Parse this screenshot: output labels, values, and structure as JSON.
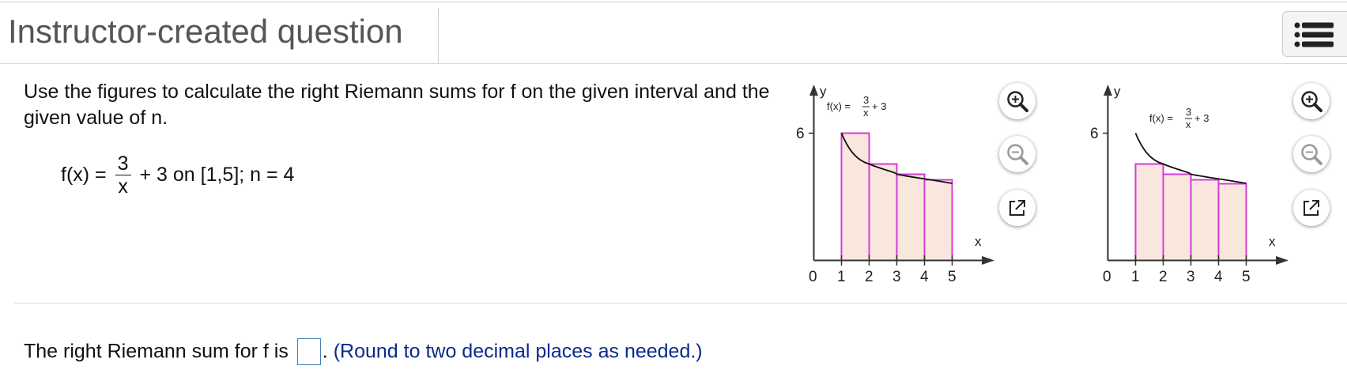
{
  "header": {
    "title": "Instructor-created question"
  },
  "question": {
    "prompt": "Use the figures to calculate the  right Riemann sums for f on the given interval and the given value of n.",
    "formula_lhs": "f(x) =",
    "formula_num": "3",
    "formula_den": "x",
    "formula_rhs": "+ 3 on [1,5]; n = 4"
  },
  "graph1": {
    "y_label": "y",
    "x_label": "x",
    "func_lhs": "f(x) =",
    "func_num": "3",
    "func_den": "x",
    "func_rhs": "+ 3",
    "y_tick": "6",
    "x_ticks": [
      "0",
      "1",
      "2",
      "3",
      "4",
      "5"
    ]
  },
  "graph2": {
    "y_label": "y",
    "x_label": "x",
    "func_lhs": "f(x) =",
    "func_num": "3",
    "func_den": "x",
    "func_rhs": "+ 3",
    "y_tick": "6",
    "x_ticks": [
      "0",
      "1",
      "2",
      "3",
      "4",
      "5"
    ]
  },
  "answer": {
    "prefix": "The right Riemann sum for f is",
    "suffix": ".",
    "hint": "(Round to two decimal places as needed.)"
  },
  "colors": {
    "rect_stroke": "#d53cd6",
    "rect_fill": "#f9e6dc",
    "axis": "#333333",
    "hint": "#0a2a8a",
    "input_border": "#4a7fb0"
  },
  "icons": [
    "list-menu-icon",
    "zoom-in-icon",
    "zoom-out-icon",
    "popout-icon"
  ]
}
